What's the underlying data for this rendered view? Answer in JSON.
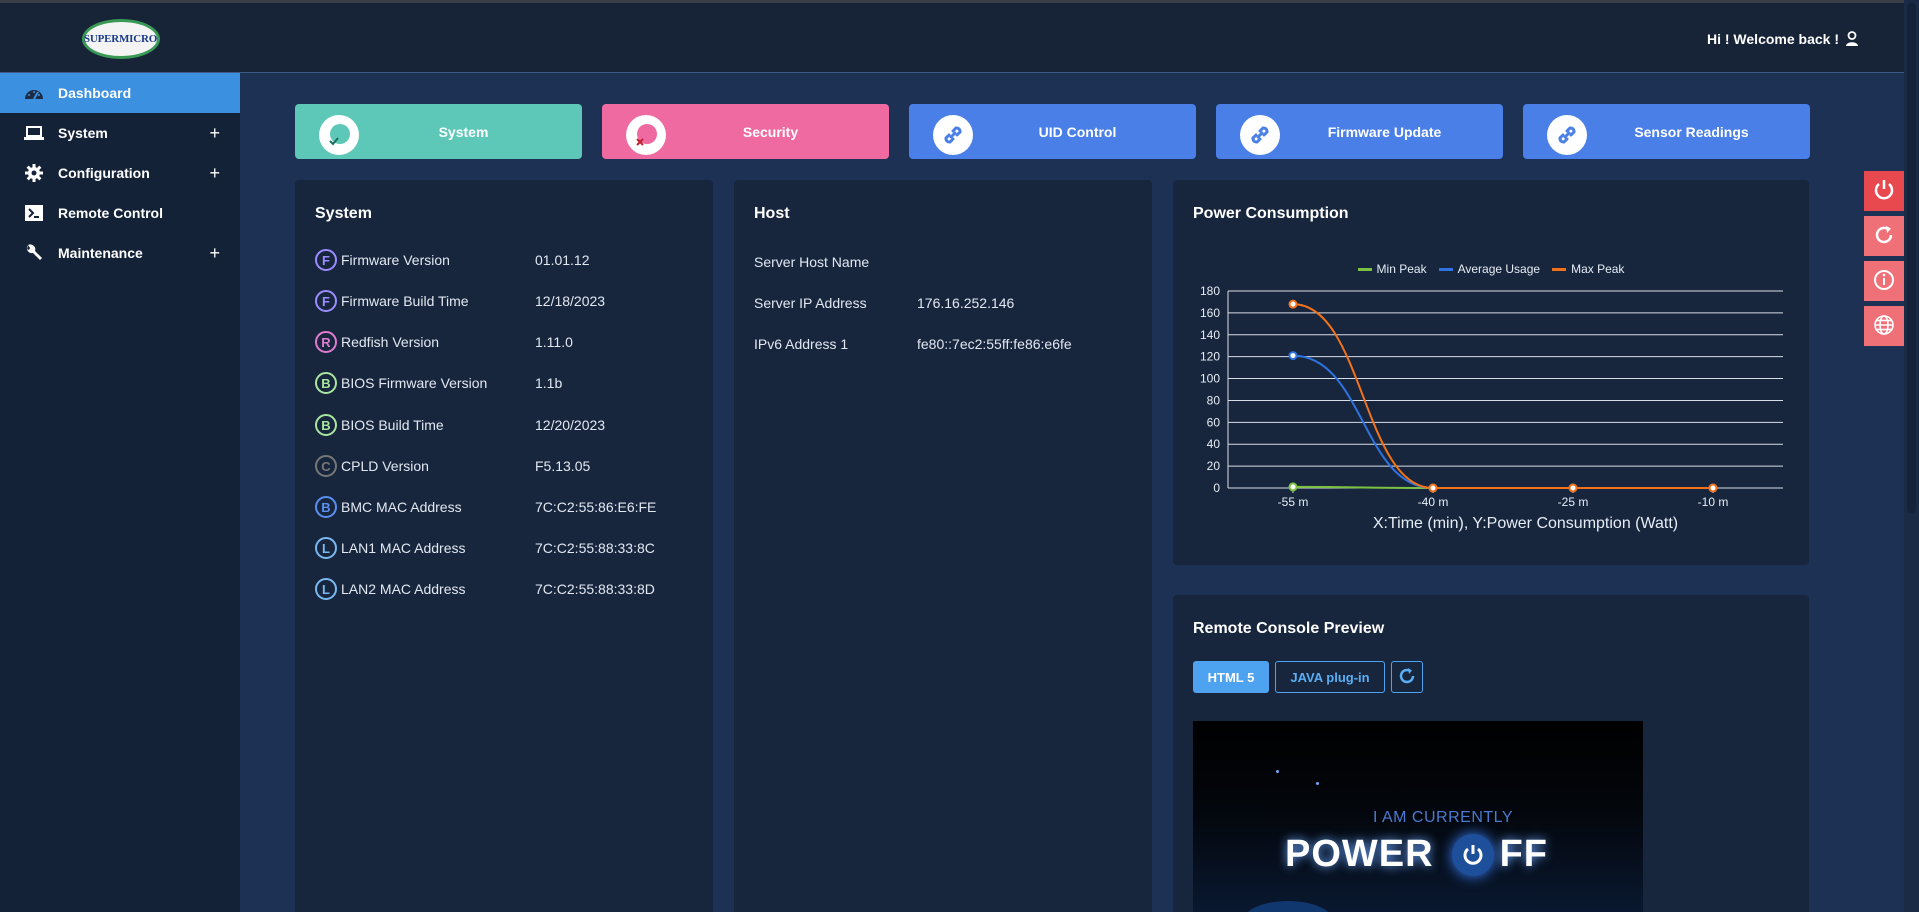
{
  "header": {
    "logo_text": "SUPERMICRO",
    "welcome": "Hi ! Welcome back !"
  },
  "sidebar": {
    "items": [
      {
        "label": "Dashboard",
        "icon": "gauge-icon",
        "expandable": false,
        "active": true
      },
      {
        "label": "System",
        "icon": "laptop-icon",
        "expandable": true
      },
      {
        "label": "Configuration",
        "icon": "gear-icon",
        "expandable": true
      },
      {
        "label": "Remote Control",
        "icon": "terminal-icon",
        "expandable": false
      },
      {
        "label": "Maintenance",
        "icon": "wrench-icon",
        "expandable": true
      }
    ],
    "plus_symbol": "+"
  },
  "quick_buttons": [
    {
      "label": "System",
      "color": "#5ec8b8",
      "icon": "system-status-icon"
    },
    {
      "label": "Security",
      "color": "#ef6aa0",
      "icon": "security-status-icon"
    },
    {
      "label": "UID Control",
      "color": "#4a7fe8",
      "icon": "link-icon"
    },
    {
      "label": "Firmware Update",
      "color": "#4a7fe8",
      "icon": "link-icon"
    },
    {
      "label": "Sensor Readings",
      "color": "#4a7fe8",
      "icon": "link-icon"
    }
  ],
  "system_card": {
    "title": "System",
    "rows": [
      {
        "badge": "F",
        "badge_color": "#9b8cff",
        "label": "Firmware Version",
        "value": "01.01.12"
      },
      {
        "badge": "F",
        "badge_color": "#9b8cff",
        "label": "Firmware Build Time",
        "value": "12/18/2023"
      },
      {
        "badge": "R",
        "badge_color": "#e07bd0",
        "label": "Redfish Version",
        "value": "1.11.0"
      },
      {
        "badge": "B",
        "badge_color": "#a9e6a0",
        "label": "BIOS Firmware Version",
        "value": "1.1b"
      },
      {
        "badge": "B",
        "badge_color": "#a9e6a0",
        "label": "BIOS Build Time",
        "value": "12/20/2023"
      },
      {
        "badge": "C",
        "badge_color": "#777777",
        "label": "CPLD Version",
        "value": "F5.13.05"
      },
      {
        "badge": "B",
        "badge_color": "#5a8ef0",
        "label": "BMC MAC Address",
        "value": "7C:C2:55:86:E6:FE"
      },
      {
        "badge": "L",
        "badge_color": "#7ab8f0",
        "label": "LAN1 MAC Address",
        "value": "7C:C2:55:88:33:8C"
      },
      {
        "badge": "L",
        "badge_color": "#7ab8f0",
        "label": "LAN2 MAC Address",
        "value": "7C:C2:55:88:33:8D"
      }
    ]
  },
  "host_card": {
    "title": "Host",
    "rows": [
      {
        "label": "Server Host Name",
        "value": ""
      },
      {
        "label": "Server IP Address",
        "value": "176.16.252.146"
      },
      {
        "label": "IPv6 Address 1",
        "value": "fe80::7ec2:55ff:fe86:e6fe"
      }
    ]
  },
  "power_card": {
    "title": "Power Consumption"
  },
  "chart_data": {
    "type": "line",
    "title": "",
    "x": [
      "-55 m",
      "-40 m",
      "-25 m",
      "-10 m"
    ],
    "xlabel": "X:Time (min), Y:Power Consumption (Watt)",
    "ylabel": "",
    "ylim": [
      0,
      180
    ],
    "yticks": [
      0,
      20,
      40,
      60,
      80,
      100,
      120,
      140,
      160,
      180
    ],
    "grid": true,
    "legend_position": "top",
    "series": [
      {
        "name": "Min Peak",
        "color": "#7cc242",
        "values": [
          1,
          0,
          0,
          0
        ]
      },
      {
        "name": "Average Usage",
        "color": "#2f73e0",
        "values": [
          121,
          0,
          0,
          0
        ]
      },
      {
        "name": "Max Peak",
        "color": "#f2721c",
        "values": [
          168,
          0,
          0,
          0
        ]
      }
    ]
  },
  "console_card": {
    "title": "Remote Console Preview",
    "html5_label": "HTML 5",
    "java_label": "JAVA plug-in",
    "preview_line1": "I AM CURRENTLY",
    "preview_word1": "POWER",
    "preview_word2": "FF"
  },
  "side_actions": [
    {
      "icon": "power-icon"
    },
    {
      "icon": "reset-icon"
    },
    {
      "icon": "info-icon"
    },
    {
      "icon": "globe-icon"
    }
  ]
}
